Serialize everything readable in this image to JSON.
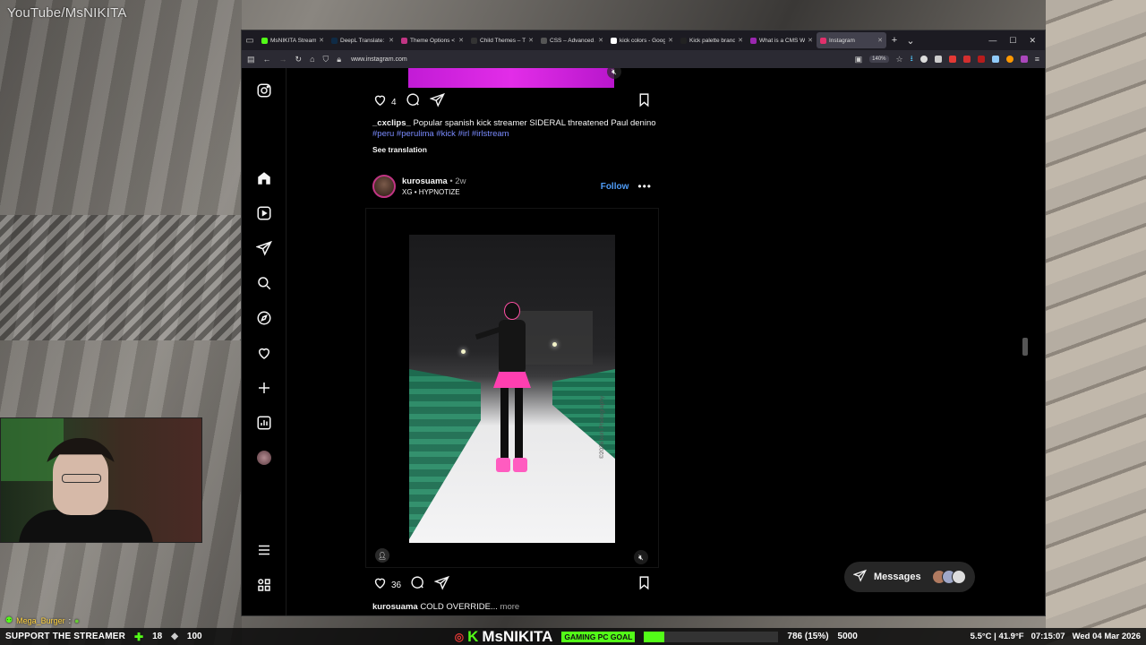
{
  "overlay": {
    "watermark": "YouTube/MsNIKITA",
    "chat": {
      "user": "Mega_Burger",
      "sep": ":"
    },
    "bottom": {
      "support": "SUPPORT THE STREAMER",
      "sub_count": "18",
      "bits": "100",
      "brand_k": "K",
      "brand_name": "MsNIKITA",
      "goal_label": "GAMING PC GOAL",
      "goal_progress": "786 (15%)",
      "goal_fraction": 0.15,
      "goal_target": "5000",
      "weather": "5.5°C | 41.9°F",
      "time": "07:15:07",
      "date": "Wed 04 Mar 2026"
    }
  },
  "browser": {
    "tabs": [
      {
        "title": "MsNIKITA Stream",
        "color": "#53fc18",
        "active": false
      },
      {
        "title": "DeepL Translate: T",
        "color": "#0f2b46",
        "active": false
      },
      {
        "title": "Theme Options < K",
        "color": "#c13584",
        "active": false
      },
      {
        "title": "Child Themes – Th",
        "color": "#333333",
        "active": false
      },
      {
        "title": "CSS – Advanced A",
        "color": "#555555",
        "active": false
      },
      {
        "title": "kick colors - Goog",
        "color": "#ffffff",
        "active": false
      },
      {
        "title": "Kick palette brand",
        "color": "#222222",
        "active": false
      },
      {
        "title": "What is a CMS W",
        "color": "#9b27b0",
        "active": false
      },
      {
        "title": "Instagram",
        "color": "#e1306c",
        "active": true
      }
    ],
    "url": "www.instagram.com",
    "zoom": "140%"
  },
  "instagram": {
    "prev_post": {
      "likes": "4",
      "caption_user": "_cxclips_",
      "caption_text": "Popular spanish kick streamer SIDERAL threatened Paul denino",
      "hashtags": "#peru #perulima #kick #irl #irlstream",
      "see_translation": "See translation"
    },
    "post": {
      "username": "kurosuama",
      "dot": "•",
      "time": "2w",
      "audio": "XG • HYPNOTIZE",
      "follow": "Follow",
      "more": "•••",
      "photo_credit": "©2026 koh Photography",
      "likes": "36",
      "caption_user": "kurosuama",
      "caption_text": "COLD OVERRIDE...",
      "caption_more": "more"
    },
    "messages_label": "Messages"
  }
}
